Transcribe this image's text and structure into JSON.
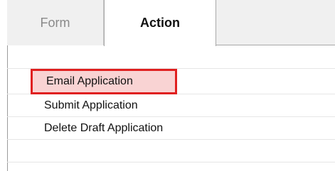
{
  "tabs": [
    {
      "label": "Form",
      "active": false
    },
    {
      "label": "Action",
      "active": true
    }
  ],
  "actions": [
    {
      "label": "Email Application",
      "highlighted": true
    },
    {
      "label": "Submit Application",
      "highlighted": false
    },
    {
      "label": "Delete Draft Application",
      "highlighted": false
    }
  ],
  "colors": {
    "highlight_border": "#e02020",
    "highlight_fill": "#f9d3d3",
    "inactive_tab_text": "#8a8a8a",
    "tab_strip_bg": "#f0f0f0"
  }
}
